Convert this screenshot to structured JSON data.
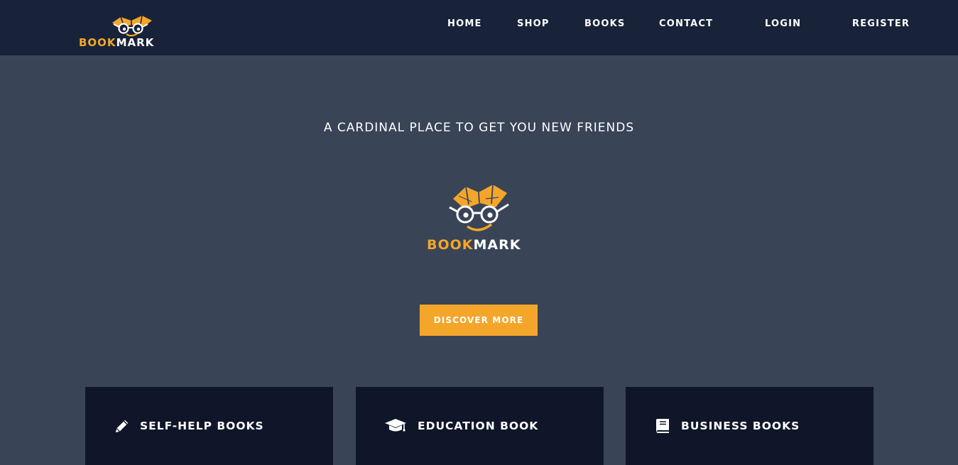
{
  "brand": {
    "part1": "BOOK",
    "part2": "MARK",
    "accent_color": "#f4a62a"
  },
  "nav": {
    "home": "HOME",
    "shop": "SHOP",
    "books": "BOOKS",
    "contact": "CONTACT",
    "login": "LOGIN",
    "register": "REGISTER"
  },
  "hero": {
    "tagline": "A CARDINAL PLACE TO GET YOU NEW FRIENDS",
    "cta": "DISCOVER MORE"
  },
  "categories": [
    {
      "label": "SELF-HELP BOOKS",
      "icon": "pencil-icon"
    },
    {
      "label": "EDUCATION BOOK",
      "icon": "graduation-cap-icon"
    },
    {
      "label": "BUSINESS BOOKS",
      "icon": "book-icon"
    }
  ],
  "colors": {
    "navbar": "#18233a",
    "background": "#394457",
    "card": "#0f1629",
    "button": "#f4a62a"
  }
}
